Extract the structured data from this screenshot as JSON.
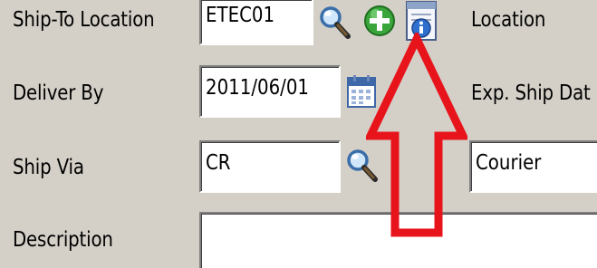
{
  "form": {
    "ship_to_location": {
      "label": "Ship-To Location",
      "value": "ETEC01"
    },
    "location": {
      "label": "Location"
    },
    "deliver_by": {
      "label": "Deliver By",
      "value": "2011/06/01"
    },
    "exp_ship_date": {
      "label": "Exp. Ship Dat"
    },
    "ship_via": {
      "label": "Ship Via",
      "value": "CR",
      "description_value": "Courier"
    },
    "description": {
      "label": "Description",
      "value": ""
    }
  },
  "icons": {
    "ship_to_lookup": "magnifier-icon",
    "ship_to_add": "add-icon",
    "ship_to_info": "info-icon",
    "deliver_by_calendar": "calendar-icon",
    "ship_via_lookup": "magnifier-icon"
  },
  "annotation": {
    "arrow_color": "#e8141c",
    "arrow_direction": "up"
  }
}
